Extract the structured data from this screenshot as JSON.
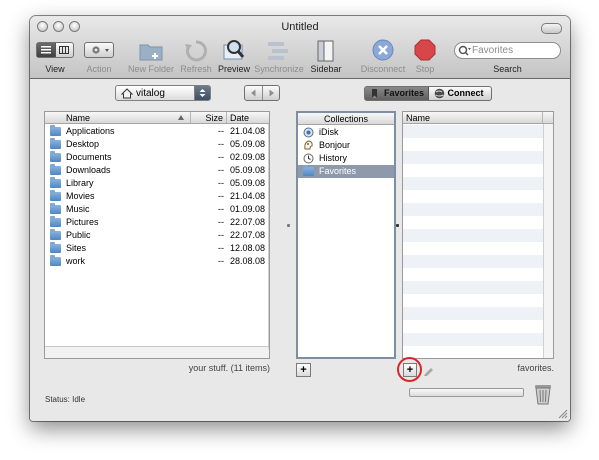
{
  "window": {
    "title": "Untitled"
  },
  "toolbar": {
    "view_label": "View",
    "action_label": "Action",
    "new_folder_label": "New Folder",
    "refresh_label": "Refresh",
    "preview_label": "Preview",
    "synchronize_label": "Synchronize",
    "sidebar_label": "Sidebar",
    "disconnect_label": "Disconnect",
    "stop_label": "Stop",
    "search_label": "Search",
    "search_placeholder": "Favorites"
  },
  "local": {
    "location": "vitalog",
    "columns": {
      "name": "Name",
      "size": "Size",
      "date": "Date"
    },
    "files": [
      {
        "name": "Applications",
        "size": "--",
        "date": "21.04.08"
      },
      {
        "name": "Desktop",
        "size": "--",
        "date": "05.09.08"
      },
      {
        "name": "Documents",
        "size": "--",
        "date": "02.09.08"
      },
      {
        "name": "Downloads",
        "size": "--",
        "date": "05.09.08"
      },
      {
        "name": "Library",
        "size": "--",
        "date": "05.09.08"
      },
      {
        "name": "Movies",
        "size": "--",
        "date": "21.04.08"
      },
      {
        "name": "Music",
        "size": "--",
        "date": "01.09.08"
      },
      {
        "name": "Pictures",
        "size": "--",
        "date": "22.07.08"
      },
      {
        "name": "Public",
        "size": "--",
        "date": "22.07.08"
      },
      {
        "name": "Sites",
        "size": "--",
        "date": "12.08.08"
      },
      {
        "name": "work",
        "size": "--",
        "date": "28.08.08"
      }
    ],
    "summary": "your stuff. (11 items)"
  },
  "remote": {
    "favorites_label": "Favorites",
    "connect_label": "Connect",
    "collections_header": "Collections",
    "collections": [
      "iDisk",
      "Bonjour",
      "History",
      "Favorites"
    ],
    "selected_collection": "Favorites",
    "name_header": "Name",
    "summary": "favorites."
  },
  "status": {
    "text": "Status: Idle"
  },
  "colors": {
    "selection": "#8e9aab",
    "highlight_ring": "#d8262a"
  }
}
